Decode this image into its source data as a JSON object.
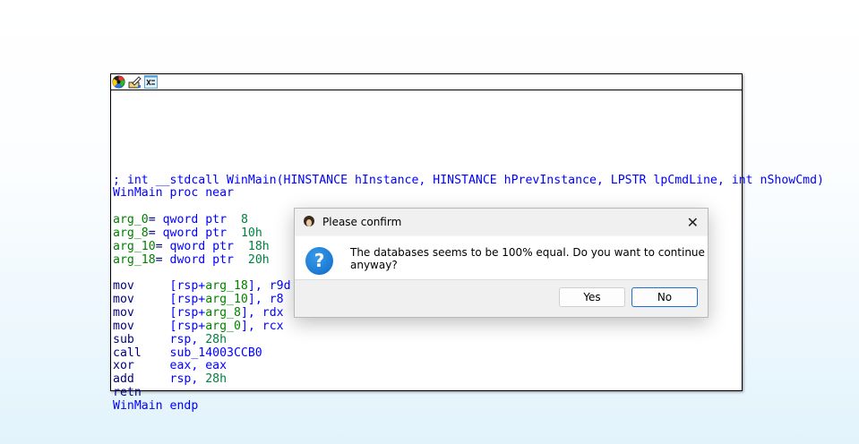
{
  "toolbar": {
    "icons": [
      "color-wheel-icon",
      "edit-icon",
      "shuffle-icon"
    ]
  },
  "code": [
    [],
    [],
    [],
    [
      [
        "t-cm",
        "; int __stdcall WinMain(HINSTANCE hInstance, HINSTANCE hPrevInstance, LPSTR lpCmdLine, int nShowCmd)"
      ]
    ],
    [
      [
        "t-op",
        "WinMain proc near"
      ]
    ],
    [],
    [
      [
        "t-arg",
        "arg_0"
      ],
      [
        "t-kw",
        "= "
      ],
      [
        "t-op",
        "qword ptr  "
      ],
      [
        "t-num",
        "8"
      ]
    ],
    [
      [
        "t-arg",
        "arg_8"
      ],
      [
        "t-kw",
        "= "
      ],
      [
        "t-op",
        "qword ptr  "
      ],
      [
        "t-num",
        "10h"
      ]
    ],
    [
      [
        "t-arg",
        "arg_10"
      ],
      [
        "t-kw",
        "= "
      ],
      [
        "t-op",
        "qword ptr  "
      ],
      [
        "t-num",
        "18h"
      ]
    ],
    [
      [
        "t-arg",
        "arg_18"
      ],
      [
        "t-kw",
        "= "
      ],
      [
        "t-op",
        "dword ptr  "
      ],
      [
        "t-num",
        "20h"
      ]
    ],
    [],
    [
      [
        "t-kw",
        "mov     "
      ],
      [
        "t-op",
        "[rsp+"
      ],
      [
        "t-arg",
        "arg_18"
      ],
      [
        "t-op",
        "], r9d"
      ]
    ],
    [
      [
        "t-kw",
        "mov     "
      ],
      [
        "t-op",
        "[rsp+"
      ],
      [
        "t-arg",
        "arg_10"
      ],
      [
        "t-op",
        "], r8"
      ]
    ],
    [
      [
        "t-kw",
        "mov     "
      ],
      [
        "t-op",
        "[rsp+"
      ],
      [
        "t-arg",
        "arg_8"
      ],
      [
        "t-op",
        "], rdx"
      ]
    ],
    [
      [
        "t-kw",
        "mov     "
      ],
      [
        "t-op",
        "[rsp+"
      ],
      [
        "t-arg",
        "arg_0"
      ],
      [
        "t-op",
        "], rcx"
      ]
    ],
    [
      [
        "t-kw",
        "sub     "
      ],
      [
        "t-op",
        "rsp, "
      ],
      [
        "t-num",
        "28h"
      ]
    ],
    [
      [
        "t-kw",
        "call    "
      ],
      [
        "t-op",
        "sub_14003CCB0"
      ]
    ],
    [
      [
        "t-kw",
        "xor     "
      ],
      [
        "t-op",
        "eax, eax"
      ]
    ],
    [
      [
        "t-kw",
        "add     "
      ],
      [
        "t-op",
        "rsp, "
      ],
      [
        "t-num",
        "28h"
      ]
    ],
    [
      [
        "t-kw",
        "retn"
      ]
    ],
    [
      [
        "t-op",
        "WinMain endp"
      ]
    ]
  ],
  "dialog": {
    "title": "Please confirm",
    "message": "The databases seems to be 100% equal. Do you want to continue anyway?",
    "yes_label": "Yes",
    "no_label": "No",
    "close_glyph": "✕",
    "question_glyph": "?"
  }
}
